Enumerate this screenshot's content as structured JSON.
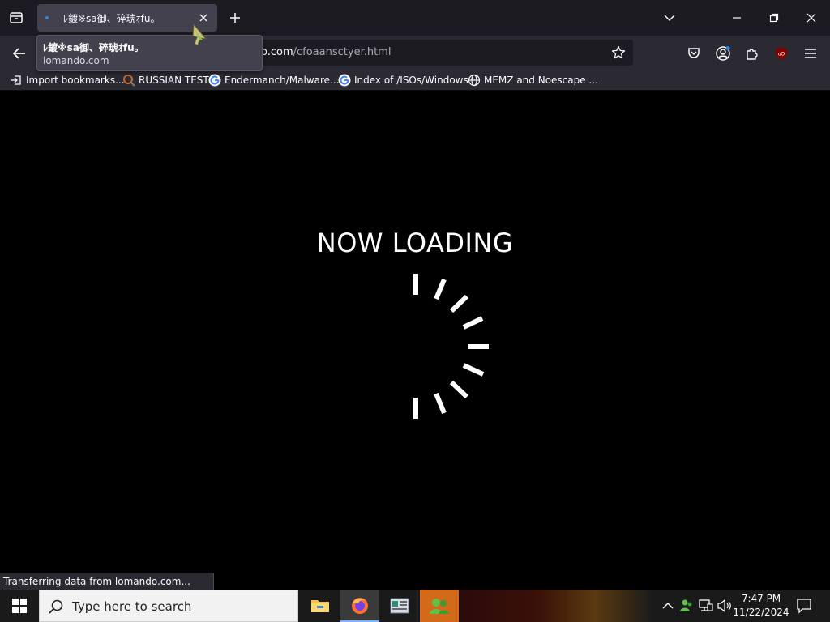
{
  "browser": {
    "tab": {
      "title": "ﾚ鍍※sa御、碎琥ｵfu。",
      "close_label": "×"
    },
    "tooltip": {
      "title": "ﾚ鍍※sa御、碎琥ｵfu。",
      "url": "lomando.com"
    },
    "url": {
      "domain": "o.com",
      "path": "/cfoaansctyer.html"
    },
    "bookmarks": [
      {
        "label": "Import bookmarks...",
        "icon": "import-icon"
      },
      {
        "label": "RUSSIAN TEST",
        "icon": "magnifier-icon"
      },
      {
        "label": "Endermanch/Malware...",
        "icon": "google-icon"
      },
      {
        "label": "Index of /ISOs/Windows",
        "icon": "google-icon"
      },
      {
        "label": "MEMZ and Noescape ...",
        "icon": "globe-icon"
      }
    ],
    "status_text": "Transferring data from lomando.com..."
  },
  "page": {
    "heading": "NOW LOADING"
  },
  "taskbar": {
    "search_placeholder": "Type here to search",
    "time": "7:47 PM",
    "date": "11/22/2024",
    "apps": [
      "file-explorer-icon",
      "firefox-icon",
      "news-app-icon",
      "people-app-icon"
    ]
  },
  "colors": {
    "tabbar_bg": "#1c1b22",
    "toolbar_bg": "#2b2a33",
    "tab_active_bg": "#42414d",
    "page_bg": "#000000",
    "spinner": "#ffffff",
    "flash_app": "#d26a1a"
  }
}
